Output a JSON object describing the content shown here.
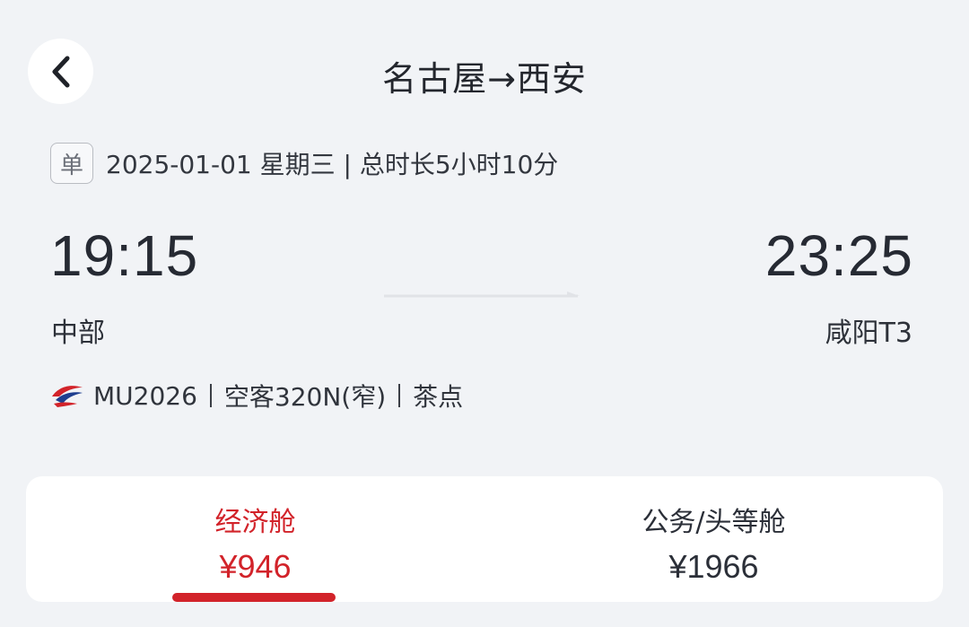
{
  "header": {
    "title": "名古屋→西安",
    "back_icon": "chevron-left-icon"
  },
  "trip": {
    "badge": "单",
    "date_info": "2025-01-01 星期三 | 总时长5小时10分"
  },
  "departure": {
    "time": "19:15",
    "airport": "中部"
  },
  "arrival": {
    "time": "23:25",
    "airport": "咸阳T3"
  },
  "flight": {
    "airline_logo": "china-eastern-logo-icon",
    "number": "MU2026",
    "aircraft": "空客320N(窄)",
    "meal": "茶点"
  },
  "cabins": [
    {
      "name": "经济舱",
      "price": "¥946",
      "active": true
    },
    {
      "name": "公务/头等舱",
      "price": "¥1966",
      "active": false
    }
  ],
  "colors": {
    "accent": "#d2232a",
    "background": "#f1f3f6",
    "card": "#ffffff"
  }
}
